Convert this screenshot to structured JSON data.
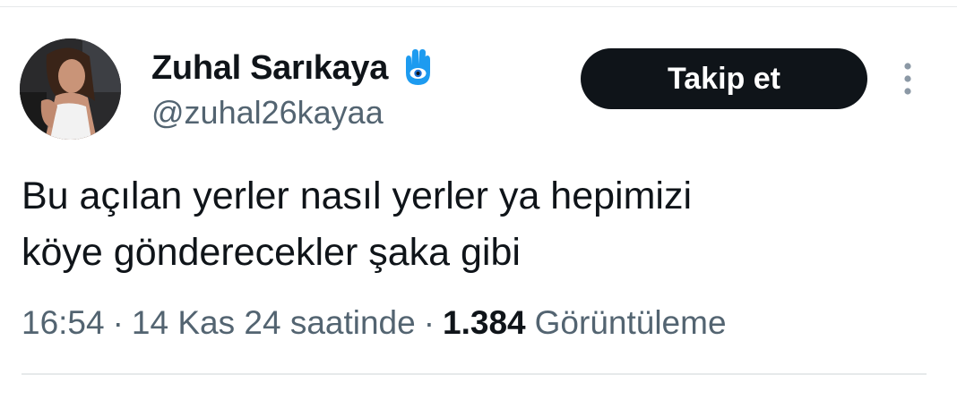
{
  "tweet": {
    "author": {
      "display_name": "Zuhal Sarıkaya",
      "handle": "@zuhal26kayaa",
      "name_badge_icon": "hamsa-evil-eye-icon",
      "avatar_icon": "profile-photo"
    },
    "follow_button_label": "Takip et",
    "more_icon": "more-vertical-icon",
    "text": "Bu açılan yerler nasıl yerler ya hepimizi\nköye gönderecekler şaka gibi",
    "meta": {
      "time": "16:54",
      "date": "14 Kas 24 saatinde",
      "separator": "·",
      "views_count": "1.384",
      "views_label": "Görüntüleme"
    }
  },
  "colors": {
    "text_primary": "#0f1419",
    "text_secondary": "#536471",
    "button_bg": "#0f1419",
    "button_text": "#ffffff",
    "badge_blue": "#1d9bf0",
    "divider": "#e6e9ea"
  }
}
